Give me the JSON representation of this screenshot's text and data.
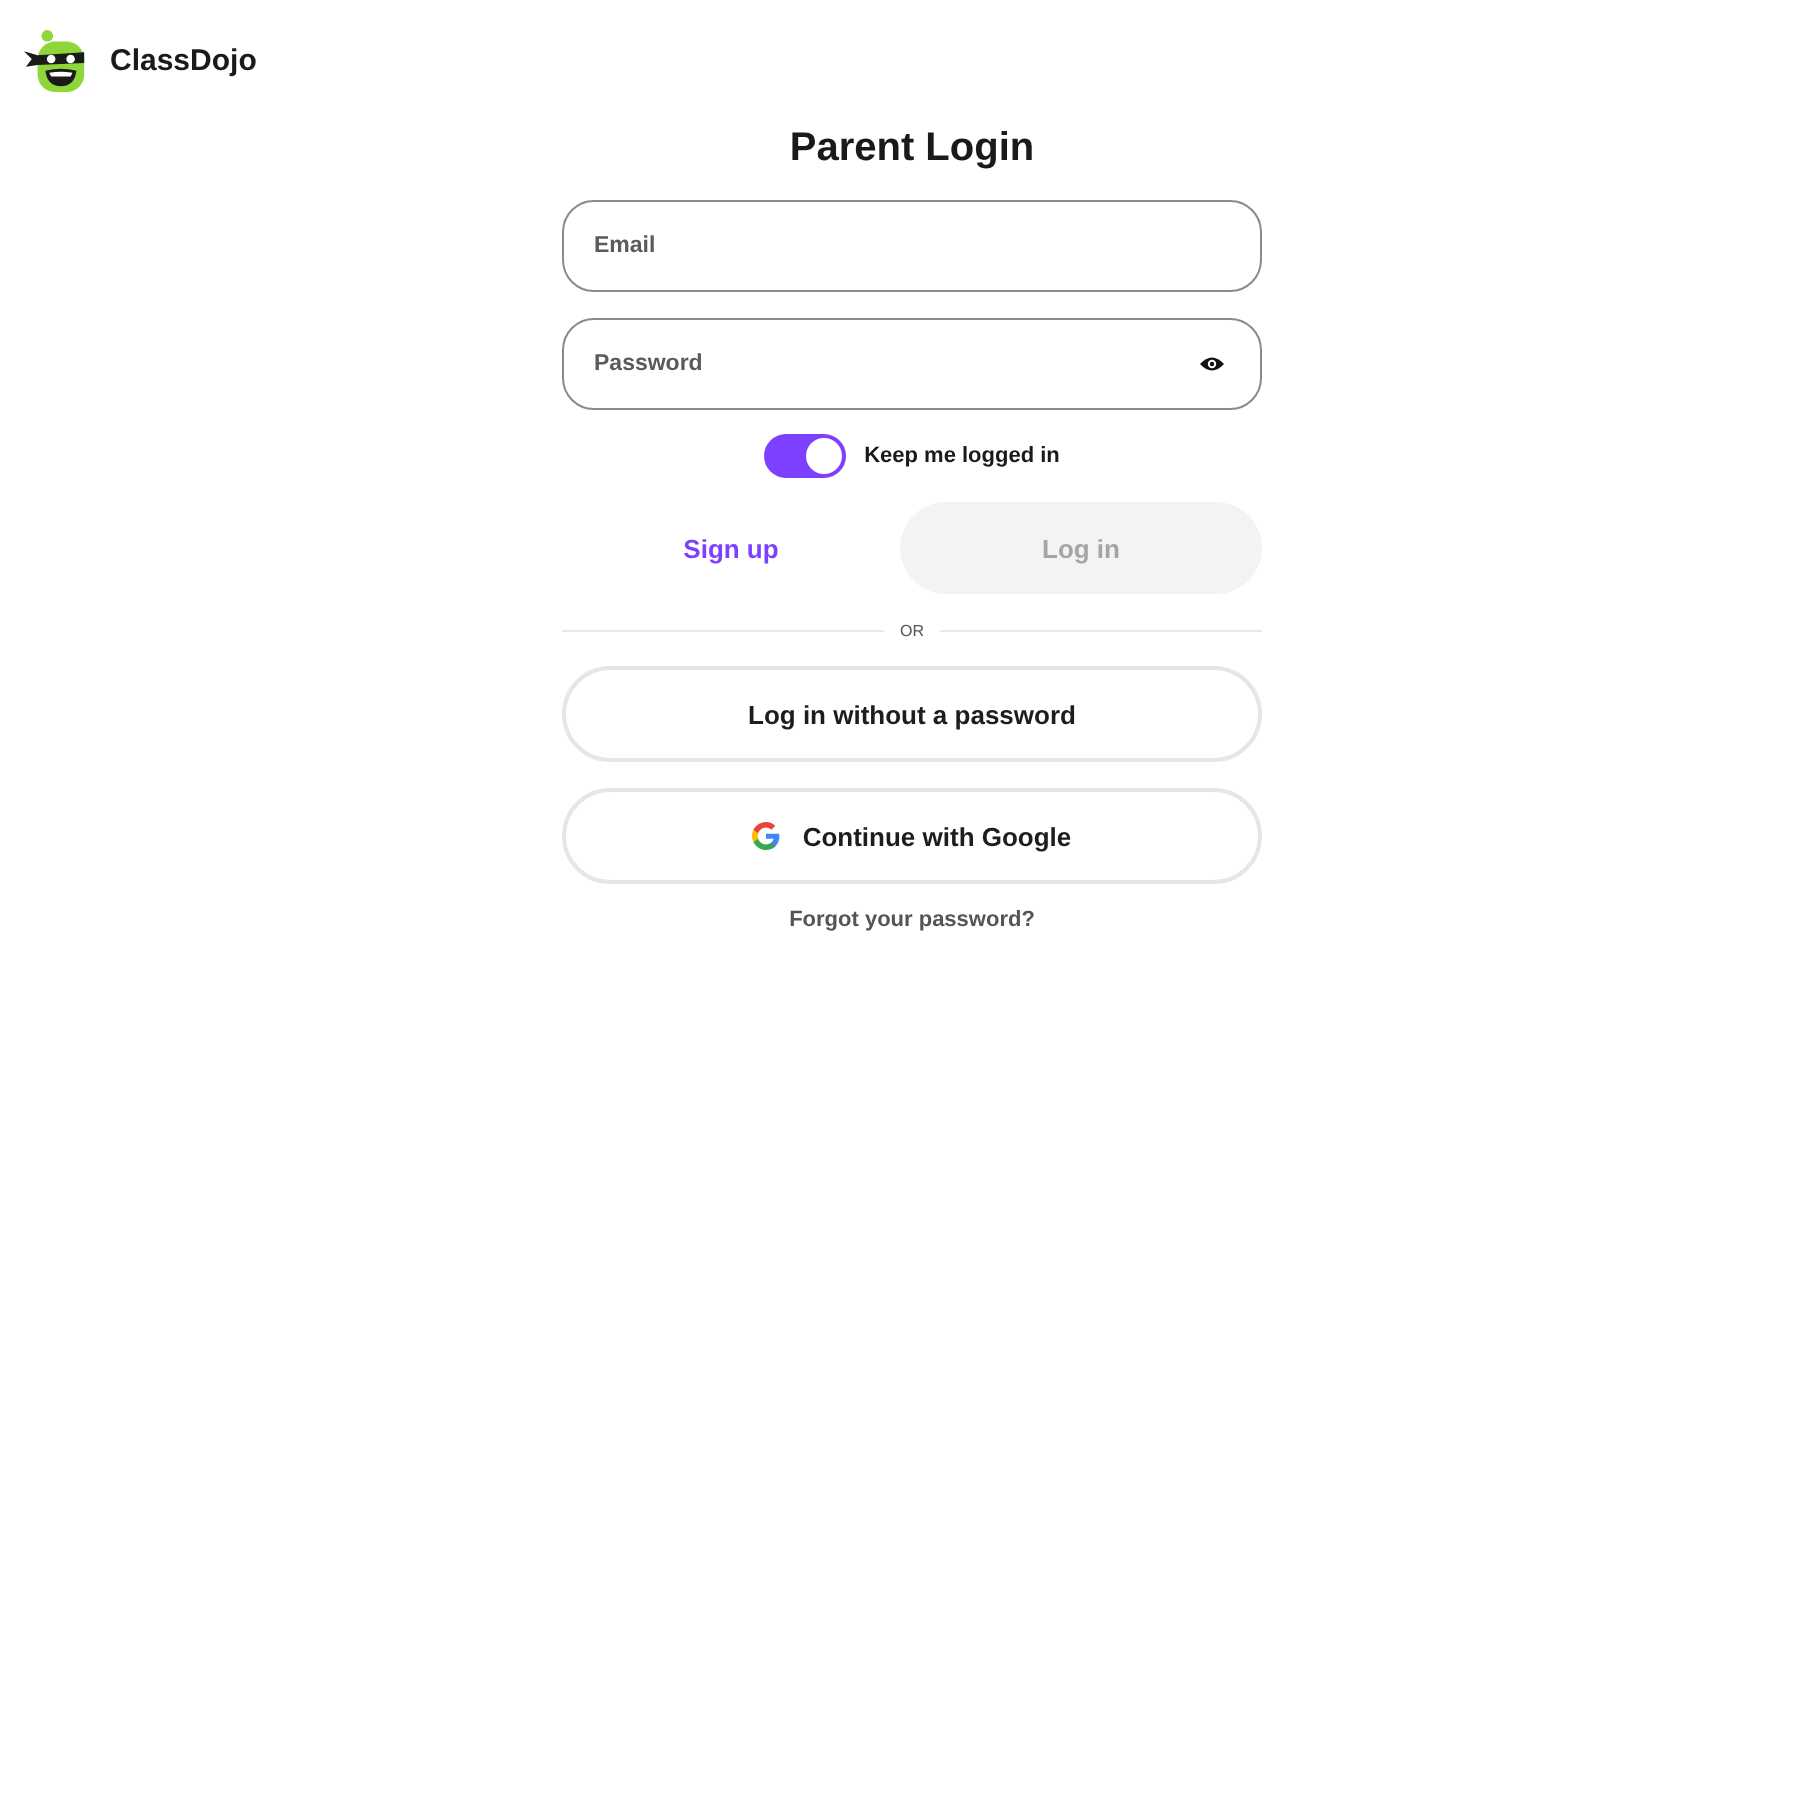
{
  "header": {
    "brand": "ClassDojo"
  },
  "title": "Parent Login",
  "fields": [
    {
      "kind": "email",
      "placeholder": "Email"
    },
    {
      "kind": "password",
      "placeholder": "Password"
    }
  ],
  "keep_logged_in": {
    "label": "Keep me logged in",
    "on": true
  },
  "actions": [
    {
      "kind": "link",
      "label": "Sign up",
      "disabled": false
    },
    {
      "kind": "button",
      "label": "Log in",
      "disabled": true
    }
  ],
  "divider": "OR",
  "alt_buttons": [
    {
      "kind": "passwordless",
      "label": "Log in without a password"
    },
    {
      "kind": "google",
      "label": "Continue with Google"
    }
  ],
  "forgot_link": "Forgot your password?"
}
